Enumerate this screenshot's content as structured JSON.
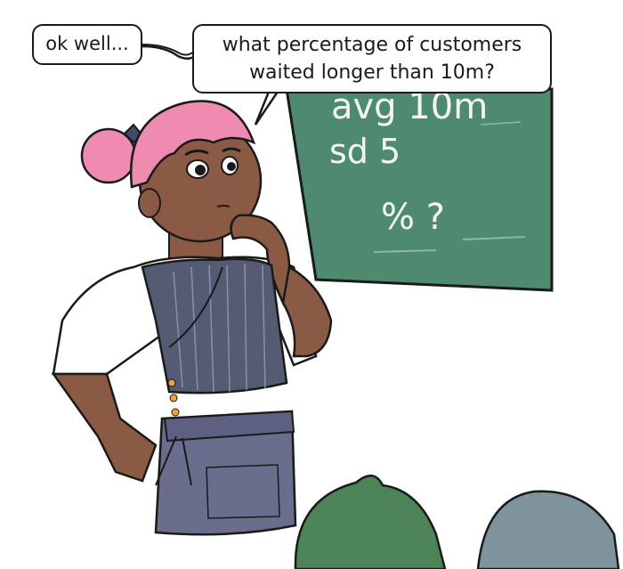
{
  "speech": {
    "left_bubble": "ok well...",
    "right_bubble_line1": "what percentage of customers",
    "right_bubble_line2": "waited longer than 10m?"
  },
  "chalkboard": {
    "line1": "avg  10m",
    "line2": "sd  5",
    "line3": "% ?"
  },
  "colors": {
    "chalkboard": "#4e8a6f",
    "hair": "#ef8bb0",
    "skin": "#8b5a45",
    "vest": "#545b72",
    "apron": "#6a6d8c",
    "shirt": "#ffffff",
    "green_head": "#4c8458",
    "gray_head": "#7e939c"
  }
}
